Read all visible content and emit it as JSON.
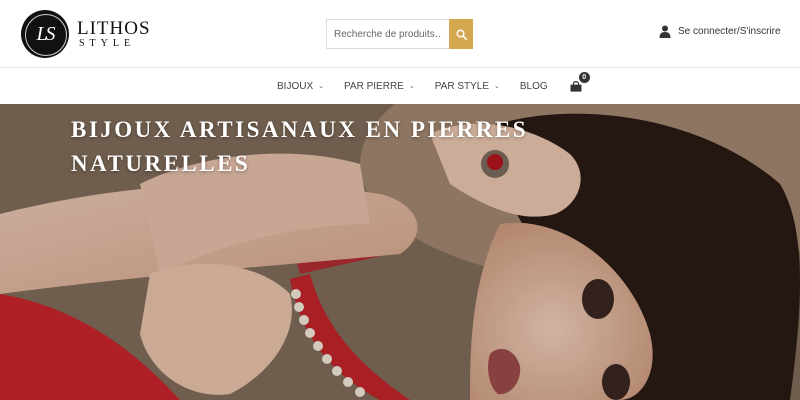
{
  "brand": {
    "name": "LITHOS",
    "tagline": "STYLE",
    "monogram": "LS"
  },
  "search": {
    "placeholder": "Recherche de produits…",
    "button_color": "#d4a84f"
  },
  "account": {
    "label": "Se connecter/S'inscrire",
    "icon": "user-icon"
  },
  "nav": {
    "items": [
      {
        "label": "BIJOUX",
        "has_dropdown": true
      },
      {
        "label": "PAR PIERRE",
        "has_dropdown": true
      },
      {
        "label": "PAR STYLE",
        "has_dropdown": true
      },
      {
        "label": "BLOG",
        "has_dropdown": false
      }
    ],
    "cart": {
      "icon": "shopping-bag-icon",
      "count": "0"
    }
  },
  "hero": {
    "title": "BIJOUX ARTISANAUX EN PIERRES NATURELLES"
  }
}
